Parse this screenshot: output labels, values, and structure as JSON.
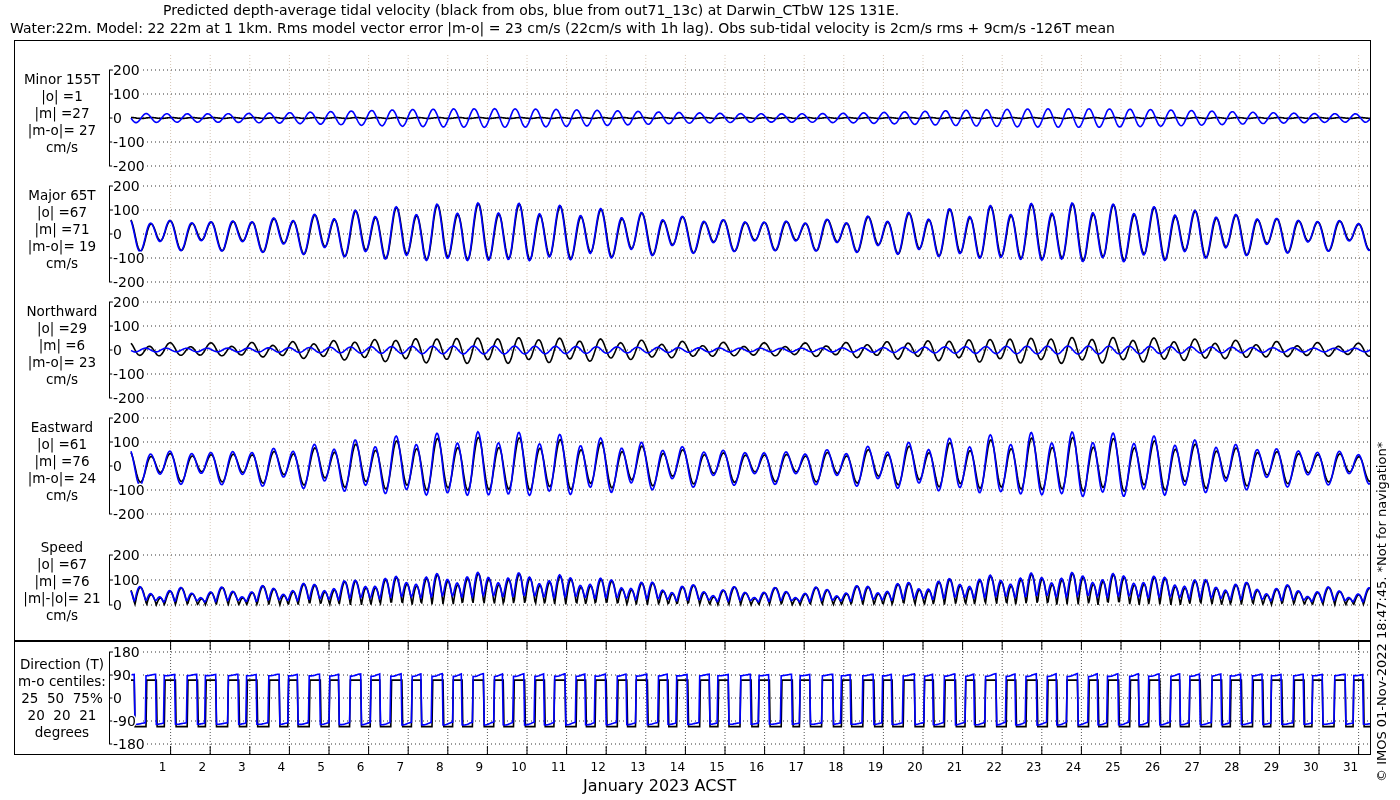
{
  "title": {
    "line_1": "Predicted depth-average tidal velocity (black from obs, blue from out71_13c) at Darwin_CTbW 12S 131E.",
    "line_2": "Water:22m. Model: 22 22m at 1 1km. Rms model vector error |m-o| = 23 cm/s (22cm/s with 1h lag). Obs sub-tidal velocity is 2cm/s rms + 9cm/s -126T mean"
  },
  "panels": [
    {
      "kind": "minor",
      "label_lines": [
        "Minor 155T",
        "|o| =1",
        "|m| =27",
        "|m-o|= 27",
        "cm/s"
      ],
      "y_ticks": [
        "200",
        "100",
        "0",
        "-100",
        "-200"
      ]
    },
    {
      "kind": "major",
      "label_lines": [
        "Major 65T",
        "|o| =67",
        "|m| =71",
        "|m-o|= 19",
        "cm/s"
      ],
      "y_ticks": [
        "200",
        "100",
        "0",
        "-100",
        "-200"
      ]
    },
    {
      "kind": "northward",
      "label_lines": [
        "Northward",
        "|o| =29",
        "|m| =6",
        "|m-o|= 23",
        "cm/s"
      ],
      "y_ticks": [
        "200",
        "100",
        "0",
        "-100",
        "-200"
      ]
    },
    {
      "kind": "eastward",
      "label_lines": [
        "Eastward",
        "|o| =61",
        "|m| =76",
        "|m-o|= 24",
        "cm/s"
      ],
      "y_ticks": [
        "200",
        "100",
        "0",
        "-100",
        "-200"
      ]
    },
    {
      "kind": "speed",
      "label_lines": [
        "Speed",
        "|o| =67",
        "|m| =76",
        "|m|-|o|= 21",
        "cm/s"
      ],
      "y_ticks": [
        "200",
        "100",
        "0"
      ]
    },
    {
      "kind": "direction",
      "label_lines": [
        "Direction (T)",
        "m-o centiles:",
        "25  50  75%",
        "20  20  21",
        "degrees"
      ],
      "y_ticks": [
        "180",
        "90",
        "0",
        "-90",
        "-180"
      ]
    }
  ],
  "x_axis": {
    "day_labels": [
      "1",
      "2",
      "3",
      "4",
      "5",
      "6",
      "7",
      "8",
      "9",
      "10",
      "11",
      "12",
      "13",
      "14",
      "15",
      "16",
      "17",
      "18",
      "19",
      "20",
      "21",
      "22",
      "23",
      "24",
      "25",
      "26",
      "27",
      "28",
      "29",
      "30",
      "31"
    ],
    "title": "January 2023 ACST"
  },
  "footer_note": "© IMOS 01-Nov-2022 18:47:45. *Not for navigation*"
}
